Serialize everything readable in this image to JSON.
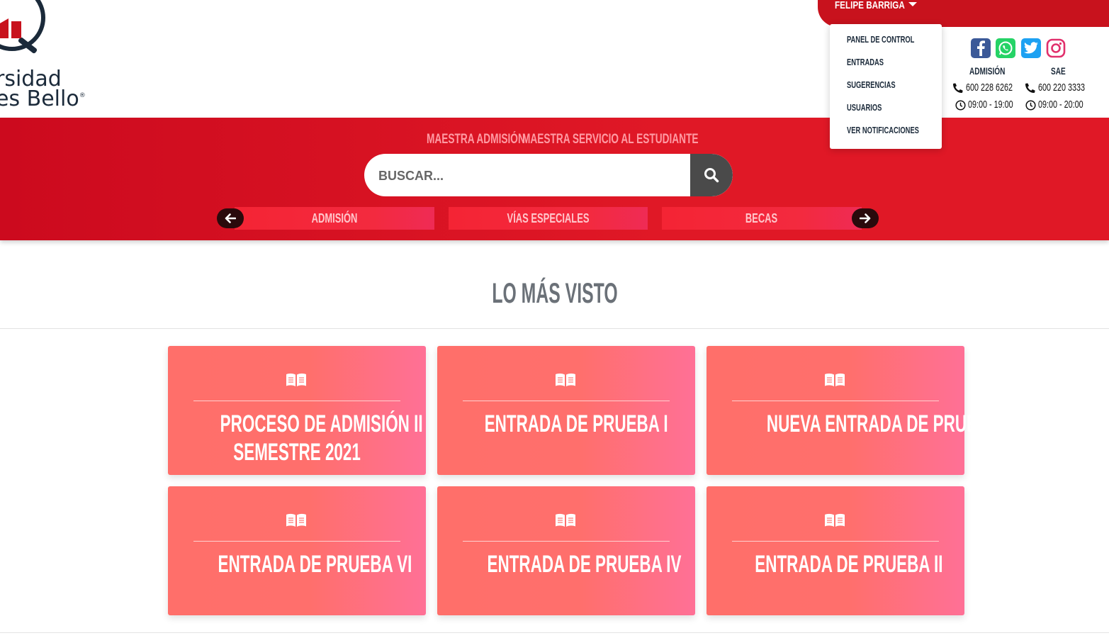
{
  "brand": {
    "logo_line1": "rsidad",
    "logo_line2": "es Bello",
    "registered": "®"
  },
  "user": {
    "name": "FELIPE BARRIGA"
  },
  "user_menu": {
    "items": [
      "PANEL DE CONTROL",
      "ENTRADAS",
      "SUGERENCIAS",
      "USUARIOS",
      "VER NOTIFICACIONES"
    ]
  },
  "social": {
    "icons": [
      "facebook-icon",
      "whatsapp-icon",
      "twitter-icon",
      "instagram-icon"
    ],
    "colors": {
      "facebook": "#3b5998",
      "whatsapp": "#25d366",
      "twitter": "#1da1f2",
      "instagram": "#e1306c"
    }
  },
  "contacts": [
    {
      "label": "ADMISIÓN",
      "phone": "600 228 6262",
      "hours": "09:00 - 19:00"
    },
    {
      "label": "SAE",
      "phone": "600 220 3333",
      "hours": "09:00 - 20:00"
    }
  ],
  "hero": {
    "links": [
      "MAESTRA ADMISIÓN",
      "MAESTRA SERVICIO AL ESTUDIANTE"
    ],
    "search_placeholder": "BUSCAR...",
    "slides": [
      "ADMISIÓN",
      "VÍAS ESPECIALES",
      "BECAS"
    ]
  },
  "section": {
    "title": "LO MÁS VISTO",
    "cards": [
      {
        "lines": [
          "PROCESO DE ADMISIÓN II",
          "SEMESTRE 2021"
        ]
      },
      {
        "lines": [
          "ENTRADA DE PRUEBA I"
        ]
      },
      {
        "lines": [
          "NUEVA ENTRADA DE PRUEBA"
        ]
      },
      {
        "lines": [
          "ENTRADA DE PRUEBA VI"
        ]
      },
      {
        "lines": [
          "ENTRADA DE PRUEBA IV"
        ]
      },
      {
        "lines": [
          "ENTRADA DE PRUEBA II"
        ]
      }
    ]
  },
  "colors": {
    "brand_red": "#c8121d",
    "navy": "#1b2a3a",
    "card_start": "#ff6f6a",
    "card_end": "#ff7096"
  }
}
